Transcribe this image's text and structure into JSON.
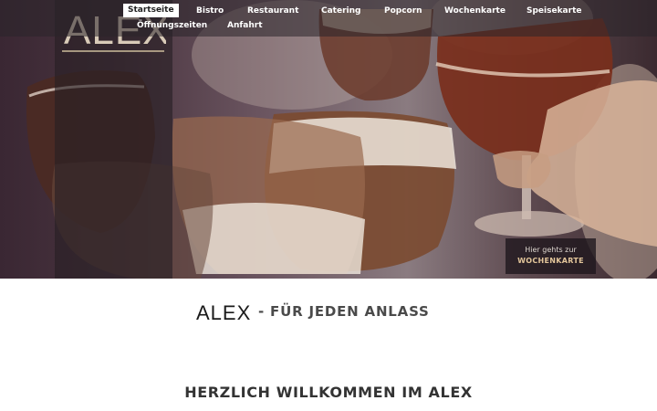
{
  "brand": {
    "logo_text": "ALEX"
  },
  "nav": {
    "items": [
      {
        "label": "Startseite",
        "active": true
      },
      {
        "label": "Bistro"
      },
      {
        "label": "Restaurant"
      },
      {
        "label": "Catering"
      },
      {
        "label": "Popcorn"
      },
      {
        "label": "Wochenkarte"
      },
      {
        "label": "Speisekarte"
      },
      {
        "label": "Öffnungszeiten"
      },
      {
        "label": "Anfahrt"
      }
    ]
  },
  "hero": {
    "cta_line1": "Hier gehts zur",
    "cta_line2": "WOCHENKARTE"
  },
  "tagline": {
    "logo_text": "ALEX",
    "text": "- FÜR JEDEN ANLASS"
  },
  "welcome": {
    "heading": "HERZLICH WILLKOMMEN IM ALEX"
  },
  "colors": {
    "accent": "#e2c59a",
    "nav_active_bg": "#ffffff",
    "text": "#4a4a4a"
  }
}
